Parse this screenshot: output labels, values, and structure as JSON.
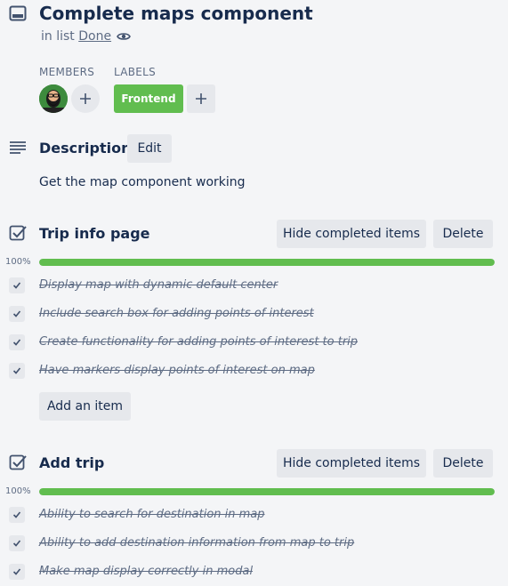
{
  "card": {
    "title": "Complete maps component",
    "in_list_prefix": "in list",
    "list_name": "Done"
  },
  "members": {
    "heading": "MEMBERS"
  },
  "labels": {
    "heading": "LABELS",
    "items": [
      "Frontend"
    ],
    "color": "#61bd4f"
  },
  "description": {
    "heading": "Description",
    "edit_label": "Edit",
    "text": "Get the map component working"
  },
  "checklists": [
    {
      "title": "Trip info page",
      "hide_label": "Hide completed items",
      "delete_label": "Delete",
      "progress_text": "100%",
      "progress": 1.0,
      "items": [
        "Display map with dynamic default center",
        "Include search box for adding points of interest",
        "Create functionality for adding points of interest to trip",
        "Have markers display points of interest on map"
      ],
      "add_item_label": "Add an item"
    },
    {
      "title": "Add trip",
      "hide_label": "Hide completed items",
      "delete_label": "Delete",
      "progress_text": "100%",
      "progress": 1.0,
      "items": [
        "Ability to search for destination in map",
        "Ability to add destination information from map to trip",
        "Make map display correctly in modal"
      ]
    }
  ],
  "colors": {
    "accent_green": "#61bd4f",
    "background": "#f4f5f7",
    "button": "#e6e8ec"
  }
}
